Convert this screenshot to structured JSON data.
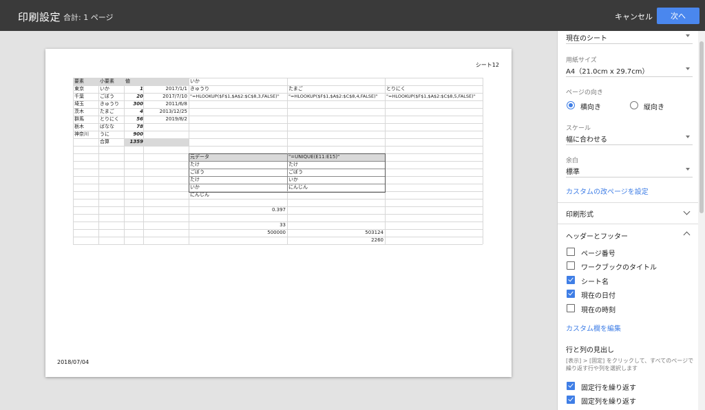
{
  "topbar": {
    "title": "印刷設定",
    "total": "合計: 1 ページ",
    "cancel_label": "キャンセル",
    "next_label": "次へ"
  },
  "page": {
    "sheet_name": "シート12",
    "date": "2018/07/04",
    "cells": {
      "A1": "要素",
      "B1": "小要素",
      "C1": "値",
      "E1": "いか",
      "A2": "東京",
      "B2": "いか",
      "C2": "1",
      "D2": "2017/1/1",
      "A3": "千葉",
      "B3": "ごぼう",
      "C3": "20",
      "D3": "2017/7/10",
      "A4": "埼玉",
      "B4": "きゅうり",
      "C4": "300",
      "D4": "2011/6/8",
      "A5": "茨木",
      "B5": "たまご",
      "C5": "4",
      "D5": "2013/12/25",
      "A6": "群馬",
      "B6": "とりにく",
      "C6": "56",
      "D6": "2019/8/2",
      "A7": "栃木",
      "B7": "ばなな",
      "C7": "78",
      "A8": "神奈川",
      "B8": "うに",
      "C8": "900",
      "B9": "合算",
      "C9": "1359",
      "E2": "きゅうり",
      "F2": "たまご",
      "G2": "とりにく",
      "E3": "\"=HLOOKUP($F$1,$A$2:$C$8,3,FALSE)\"",
      "F3": "\"=HLOOKUP($F$1,$A$2:$C$8,4,FALSE)\"",
      "G3": "\"=HLOOKUP($F$1,$A$2:$C$8,5,FALSE)\"",
      "E11": "元データ",
      "F11": "\"=UNIQUE(E11:E15)\"",
      "E12": "たけ",
      "F12": "たけ",
      "E13": "ごぼう",
      "F13": "ごぼう",
      "E14": "たけ",
      "F14": "いか",
      "E15": "いか",
      "F15": "にんじん",
      "E16": "にんじん",
      "E18": "0.397",
      "E20": "33",
      "E21": "500000",
      "F21": "503124",
      "F22": "2260"
    }
  },
  "sidebar": {
    "range_value": "現在のシート",
    "paper_label": "用紙サイズ",
    "paper_value": "A4（21.0cm x 29.7cm）",
    "orientation_label": "ページの向き",
    "orientation_landscape": "横向き",
    "orientation_portrait": "縦向き",
    "scale_label": "スケール",
    "scale_value": "幅に合わせる",
    "margin_label": "余白",
    "margin_value": "標準",
    "custom_break_link": "カスタムの改ページを設定",
    "format_section": "印刷形式",
    "header_footer_section": "ヘッダーとフッター",
    "checkboxes": [
      {
        "label": "ページ番号",
        "checked": false
      },
      {
        "label": "ワークブックのタイトル",
        "checked": false
      },
      {
        "label": "シート名",
        "checked": true
      },
      {
        "label": "現在の日付",
        "checked": true
      },
      {
        "label": "現在の時刻",
        "checked": false
      }
    ],
    "edit_custom_link": "カスタム欄を編集",
    "row_col_heading": "行と列の見出し",
    "help_text": "[表示] > [固定] をクリックして、すべてのページで繰り返す行や列を選択します",
    "repeat_checkboxes": [
      {
        "label": "固定行を繰り返す",
        "checked": true
      },
      {
        "label": "固定列を繰り返す",
        "checked": true
      }
    ]
  }
}
